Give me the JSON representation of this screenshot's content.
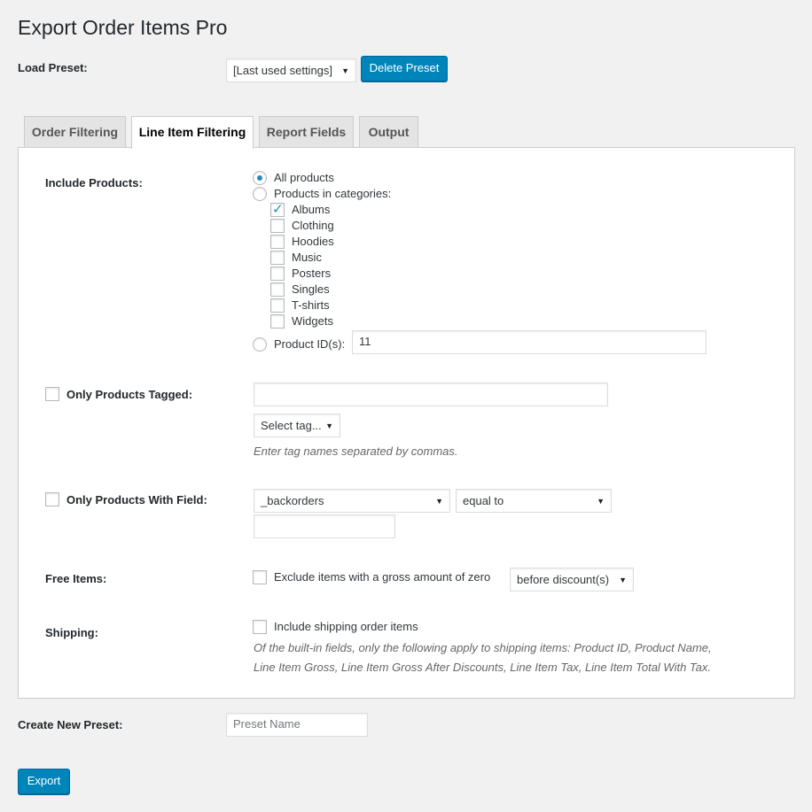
{
  "page": {
    "title": "Export Order Items Pro"
  },
  "preset": {
    "label": "Load Preset:",
    "selected": "[Last used settings]",
    "delete_button": "Delete Preset"
  },
  "tabs": [
    {
      "label": "Order Filtering",
      "active": false
    },
    {
      "label": "Line Item Filtering",
      "active": true
    },
    {
      "label": "Report Fields",
      "active": false
    },
    {
      "label": "Output",
      "active": false
    }
  ],
  "include_products": {
    "label": "Include Products:",
    "all_products": "All products",
    "in_categories": "Products in categories:",
    "selected_option": "All products",
    "categories": [
      {
        "name": "Albums",
        "checked": true
      },
      {
        "name": "Clothing",
        "checked": false
      },
      {
        "name": "Hoodies",
        "checked": false
      },
      {
        "name": "Music",
        "checked": false
      },
      {
        "name": "Posters",
        "checked": false
      },
      {
        "name": "Singles",
        "checked": false
      },
      {
        "name": "T-shirts",
        "checked": false
      },
      {
        "name": "Widgets",
        "checked": false
      }
    ],
    "product_ids_label": "Product ID(s):",
    "product_ids_value": "11"
  },
  "tagged": {
    "label": "Only Products Tagged:",
    "checked": false,
    "value": "",
    "select_tag": "Select tag...",
    "hint": "Enter tag names separated by commas."
  },
  "with_field": {
    "label": "Only Products With Field:",
    "checked": false,
    "field": "_backorders",
    "operator": "equal to",
    "value": ""
  },
  "free_items": {
    "label": "Free Items:",
    "checked": false,
    "option_text": "Exclude items with a gross amount of zero",
    "timing": "before discount(s)"
  },
  "shipping": {
    "label": "Shipping:",
    "checked": false,
    "option_text": "Include shipping order items",
    "note_line1": "Of the built-in fields, only the following apply to shipping items: Product ID, Product Name,",
    "note_line2": "Line Item Gross, Line Item Gross After Discounts, Line Item Tax, Line Item Total With Tax."
  },
  "new_preset": {
    "label": "Create New Preset:",
    "placeholder": "Preset Name"
  },
  "export_button": "Export",
  "colors": {
    "primary": "#0085ba",
    "accent": "#1e8cbe",
    "background": "#f1f1f1"
  }
}
